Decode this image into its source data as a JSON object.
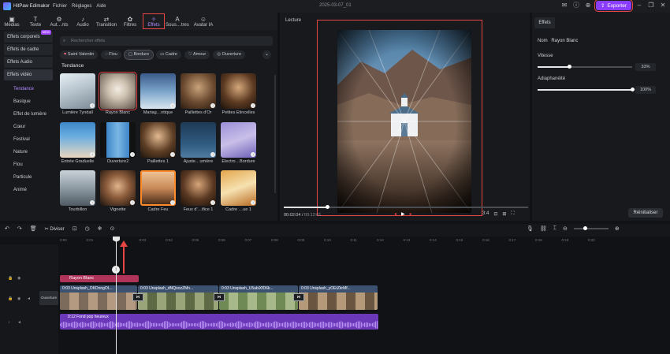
{
  "app": {
    "title": "HitPaw Edimakor",
    "menus": [
      "Fichier",
      "Réglages",
      "Aide"
    ],
    "project_date": "2025-03-07_01",
    "export_label": "Exporter"
  },
  "toolbar": {
    "items": [
      {
        "label": "Médias",
        "icon": "media-icon"
      },
      {
        "label": "Texte",
        "icon": "text-icon"
      },
      {
        "label": "Aut…nts",
        "icon": "auto-icon"
      },
      {
        "label": "Audio",
        "icon": "audio-icon"
      },
      {
        "label": "Transition",
        "icon": "transition-icon"
      },
      {
        "label": "Filtres",
        "icon": "filters-icon"
      },
      {
        "label": "Effets",
        "icon": "effects-icon"
      },
      {
        "label": "Sous…tres",
        "icon": "subtitles-icon"
      },
      {
        "label": "Avatar IA",
        "icon": "avatar-icon"
      }
    ],
    "active": "Effets"
  },
  "sidebar": {
    "categories": [
      {
        "label": "Effets corporels",
        "badge": "NEW"
      },
      {
        "label": "Effets de cadre"
      },
      {
        "label": "Effets Audio"
      },
      {
        "label": "Effets vidéo"
      }
    ],
    "subcategories": [
      "Tendance",
      "Basique",
      "Effet de lumière",
      "Cœur",
      "Festival",
      "Nature",
      "Flou",
      "Particule",
      "Animé"
    ],
    "active_sub": "Tendance"
  },
  "search": {
    "placeholder": "Rechercher effets"
  },
  "chips": [
    "Saint Valentin",
    "Flou",
    "Bordure",
    "Cadre",
    "Amour",
    "Ouverture"
  ],
  "section_title": "Tendance",
  "effects": [
    {
      "label": "Lumière Tyndall"
    },
    {
      "label": "Rayon Blanc"
    },
    {
      "label": "Mariag…ntique"
    },
    {
      "label": "Paillettes d'Or"
    },
    {
      "label": "Petites Étincelles"
    },
    {
      "label": "Entrée Graduelle"
    },
    {
      "label": "Ouverture2"
    },
    {
      "label": "Paillettes 1"
    },
    {
      "label": "Ajuste…umière"
    },
    {
      "label": "Électro…Bordure"
    },
    {
      "label": "Tourbillon"
    },
    {
      "label": "Vignette"
    },
    {
      "label": "Cadre Feu"
    },
    {
      "label": "Feux d'…ifice 1"
    },
    {
      "label": "Cadre …ue 1"
    }
  ],
  "preview": {
    "title": "Lecture",
    "current_time": "00:02:04",
    "total_time": "00:12:01",
    "progress": 0.17,
    "zoom_hint": "3:4"
  },
  "inspector": {
    "tab": "Effets",
    "name_label": "Nom",
    "name_value": "Rayon Blanc",
    "speed_label": "Vitesse",
    "speed_value": "33%",
    "speed_level": 0.33,
    "opacity_label": "Adiaphanéité",
    "opacity_value": "100%",
    "opacity_level": 1.0,
    "reset_label": "Réinitialiser"
  },
  "timeline": {
    "split_label": "Diviser",
    "ruler_ticks": [
      "0:00",
      "0:01",
      "0:02",
      "0:03",
      "0:04",
      "0:05",
      "0:06",
      "0:07",
      "0:08",
      "0:09",
      "0:10",
      "0:11",
      "0:12",
      "0:13",
      "0:14",
      "0:15",
      "0:16",
      "0:17",
      "0:18",
      "0:19",
      "0:20"
    ],
    "effect_clip": "Rayon Blanc",
    "transition_label": "Ouverture",
    "video_clips": [
      {
        "name": "0:03 Unsplash_OKDnngOL..."
      },
      {
        "name": "0:03 Unsplash_dNQoozZMn..."
      },
      {
        "name": "0:03 Unsplash_U5abiXfD6k..."
      },
      {
        "name": "0:03 Unsplash_yOEtZkrMf..."
      }
    ],
    "audio_clip": "0:12 Fond pop heureux"
  },
  "colors": {
    "accent": "#8a3dff",
    "highlight": "#e84545",
    "effect_clip": "#b0335a",
    "audio_clip": "#6a38b8",
    "video_clip": "#3c5070"
  }
}
